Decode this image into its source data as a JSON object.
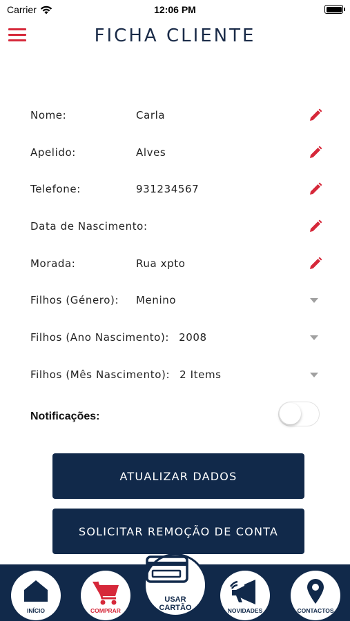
{
  "status_bar": {
    "carrier": "Carrier",
    "time": "12:06 PM"
  },
  "header": {
    "title": "FICHA CLIENTE"
  },
  "form": {
    "rows": [
      {
        "label": "Nome:",
        "value": "Carla",
        "control": "edit"
      },
      {
        "label": "Apelido:",
        "value": "Alves",
        "control": "edit"
      },
      {
        "label": "Telefone:",
        "value": "931234567",
        "control": "edit"
      },
      {
        "label": "Data de Nascimento:",
        "value": "",
        "control": "edit"
      },
      {
        "label": "Morada:",
        "value": "Rua xpto",
        "control": "edit"
      },
      {
        "label": "Filhos (Género):",
        "value": "Menino",
        "control": "dropdown"
      },
      {
        "label": "Filhos (Ano Nascimento):",
        "value": "2008",
        "control": "dropdown"
      },
      {
        "label": "Filhos (Mês Nascimento):",
        "value": "2 Items",
        "control": "dropdown"
      }
    ],
    "notifications_label": "Notificações:",
    "notifications_enabled": false
  },
  "buttons": {
    "update": "ATUALIZAR DADOS",
    "remove": "SOLICITAR REMOÇÃO DE CONTA"
  },
  "tabbar": {
    "inicio": "INÍCIO",
    "comprar": "COMPRAR",
    "usar_line1": "USAR",
    "usar_line2": "CARTÃO",
    "novidades": "NOVIDADES",
    "contactos": "CONTACTOS"
  },
  "colors": {
    "navy": "#11294a",
    "accent_red": "#d6283a"
  }
}
